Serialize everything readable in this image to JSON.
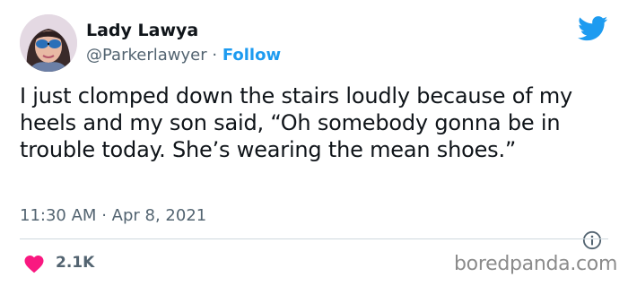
{
  "author": {
    "display_name": "Lady Lawya",
    "handle": "@Parkerlawyer",
    "separator": "·",
    "follow_label": "Follow"
  },
  "tweet": {
    "text": "I just clomped down the stairs loudly because of my heels and my son said, “Oh somebody gonna be in trouble today. She’s wearing the mean shoes.”",
    "time": "11:30 AM",
    "separator": "·",
    "date": "Apr 8, 2021"
  },
  "engagement": {
    "likes": "2.1K"
  },
  "watermark": "boredpanda.com",
  "icons": {
    "platform": "twitter-bird-icon",
    "like": "heart-icon",
    "info": "info-icon"
  },
  "colors": {
    "accent": "#1d9bf0",
    "heart": "#f91880",
    "muted": "#536471",
    "text": "#0f1419"
  }
}
